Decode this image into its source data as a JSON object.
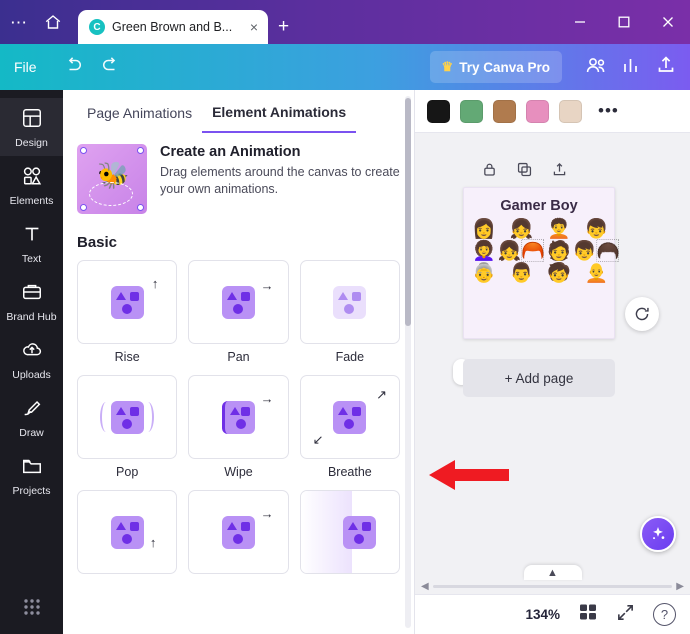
{
  "browser": {
    "menu_icon": "ellipsis-icon",
    "home_icon": "home-icon",
    "tab": {
      "favicon": "canva-favicon",
      "favicon_letter": "C",
      "title": "Green Brown and B...",
      "close_label": "×"
    },
    "new_tab_label": "+",
    "window": {
      "minimize": "—",
      "maximize": "☐",
      "close": "✕"
    }
  },
  "canva_toolbar": {
    "file_label": "File",
    "undo_icon": "undo-arrow-icon",
    "redo_icon": "redo-arrow-icon",
    "pro_button": {
      "crown": "♛",
      "label": "Try Canva Pro"
    },
    "share_icon": "share-upload-icon",
    "insights_icon": "bar-chart-icon",
    "collaborators_icon": "people-icon"
  },
  "rail": {
    "items": [
      {
        "label": "Design",
        "icon": "design-grid-icon",
        "active": true
      },
      {
        "label": "Elements",
        "icon": "elements-shapes-icon",
        "active": false
      },
      {
        "label": "Text",
        "icon": "text-t-icon",
        "active": false
      },
      {
        "label": "Brand Hub",
        "icon": "brand-hub-icon",
        "active": false
      },
      {
        "label": "Uploads",
        "icon": "uploads-cloud-icon",
        "active": false
      },
      {
        "label": "Draw",
        "icon": "draw-pen-icon",
        "active": false
      },
      {
        "label": "Projects",
        "icon": "projects-folder-icon",
        "active": false
      }
    ],
    "apps_icon": "apps-dots-icon"
  },
  "panel": {
    "tabs": [
      {
        "label": "Page Animations",
        "active": false
      },
      {
        "label": "Element Animations",
        "active": true
      }
    ],
    "promo": {
      "thumb_icon": "bee-sticker-thumbnail",
      "title": "Create an Animation",
      "subtitle": "Drag elements around the canvas to create your own animations."
    },
    "section_title": "Basic",
    "animations": [
      {
        "name": "Rise",
        "arrow": "↑",
        "arrow_pos": "top-right",
        "pale": false
      },
      {
        "name": "Pan",
        "arrow": "→",
        "arrow_pos": "top-right",
        "pale": false
      },
      {
        "name": "Fade",
        "arrow": "",
        "arrow_pos": "none",
        "pale": true
      },
      {
        "name": "Pop",
        "arrow": "",
        "arrow_pos": "none",
        "pale": false
      },
      {
        "name": "Wipe",
        "arrow": "→",
        "arrow_pos": "top-right",
        "pale": false
      },
      {
        "name": "Breathe",
        "arrow": "↗",
        "arrow_pos": "top-right",
        "pale": false
      },
      {
        "name": "",
        "arrow": "↑",
        "arrow_pos": "bottom-right",
        "pale": false
      },
      {
        "name": "",
        "arrow": "→",
        "arrow_pos": "top-right",
        "pale": false
      },
      {
        "name": "",
        "arrow": "",
        "arrow_pos": "none",
        "pale": false
      }
    ],
    "scrollbar": "panel-scrollbar"
  },
  "context_bar": {
    "swatches": [
      "#161616",
      "#63a975",
      "#b07b4e",
      "#e78fbe",
      "#e8d5c4"
    ],
    "more_label": "•••"
  },
  "canvas": {
    "float_tools": [
      {
        "icon": "lock-icon"
      },
      {
        "icon": "duplicate-icon"
      },
      {
        "icon": "export-page-icon"
      }
    ],
    "page": {
      "title": "Gamer Boy",
      "avatars": [
        "👩",
        "👧",
        "🧑‍🦱",
        "👦",
        "👩‍🦱",
        "👧‍🦰",
        "🧑",
        "👦‍🦱",
        "👵",
        "👨",
        "🧒",
        "🧑‍🦲"
      ]
    },
    "refresh_icon": "refresh-animation-icon",
    "add_page_label": "+ Add page",
    "pointer_arrow": "red-left-arrow-annotation",
    "magic_icon": "magic-sparkle-icon",
    "expand_chevron": "chevron-up-icon",
    "hscroll_left": "◀",
    "hscroll_right": "▶"
  },
  "status_bar": {
    "zoom": "134%",
    "grid_view_icon": "grid-view-icon",
    "fullscreen_icon": "fullscreen-icon",
    "help_label": "?"
  }
}
